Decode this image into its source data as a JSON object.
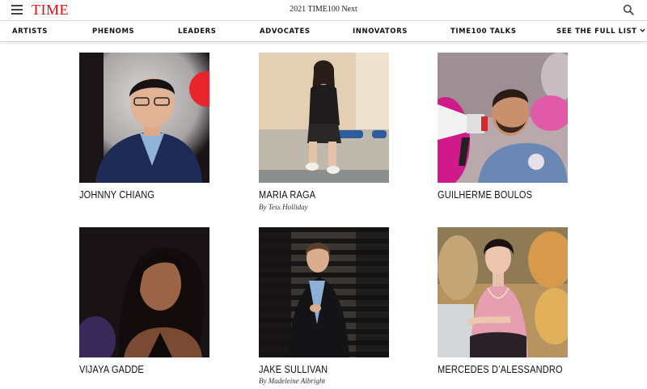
{
  "header": {
    "logo": "TIME",
    "title": "2021 TIME100 Next",
    "menu_icon": "hamburger-menu-icon",
    "search_icon": "search-icon",
    "brand_color": "#e90606"
  },
  "nav": {
    "items": [
      {
        "label": "ARTISTS"
      },
      {
        "label": "PHENOMS"
      },
      {
        "label": "LEADERS"
      },
      {
        "label": "ADVOCATES"
      },
      {
        "label": "INNOVATORS"
      },
      {
        "label": "TIME100 TALKS"
      },
      {
        "label": "SEE THE FULL LIST",
        "icon": "chevron-down-icon"
      }
    ]
  },
  "honorees": [
    {
      "name": "JOHNNY CHIANG",
      "byline": ""
    },
    {
      "name": "MARIA RAGA",
      "byline": "By Tess Holliday"
    },
    {
      "name": "GUILHERME BOULOS",
      "byline": ""
    },
    {
      "name": "VIJAYA GADDE",
      "byline": ""
    },
    {
      "name": "JAKE SULLIVAN",
      "byline": "By Madeleine Albright"
    },
    {
      "name": "MERCEDES D’ALESSANDRO",
      "byline": ""
    }
  ]
}
